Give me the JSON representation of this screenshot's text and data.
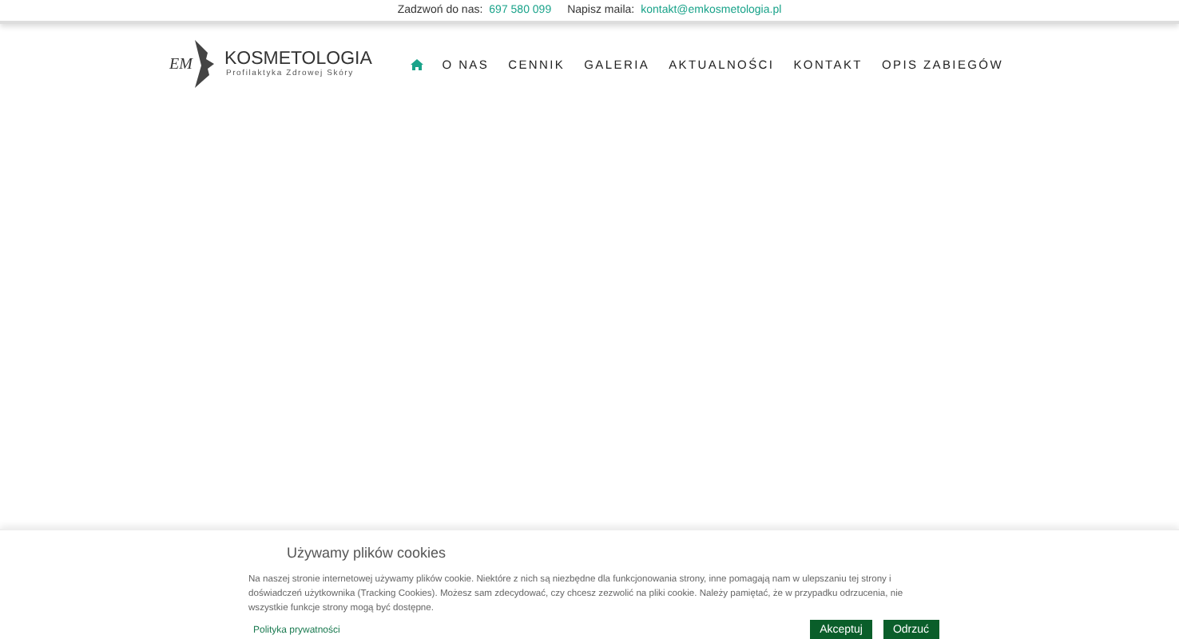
{
  "topbar": {
    "phone_label": "Zadzwoń do nas:",
    "phone": "697 580 099",
    "mail_label": "Napisz maila:",
    "mail": "kontakt@emkosmetologia.pl"
  },
  "logo": {
    "mark": "EM",
    "title": "KOSMETOLOGIA",
    "subtitle": "Profilaktyka Zdrowej Skóry"
  },
  "nav": [
    {
      "kind": "home",
      "selected": true
    },
    {
      "kind": "text",
      "label": "O NAS",
      "selected": false
    },
    {
      "kind": "text",
      "label": "CENNIK",
      "selected": false
    },
    {
      "kind": "text",
      "label": "GALERIA",
      "selected": false
    },
    {
      "kind": "text",
      "label": "AKTUALNOŚCI",
      "selected": false
    },
    {
      "kind": "text",
      "label": "KONTAKT",
      "selected": false
    },
    {
      "kind": "text",
      "label": "OPIS ZABIEGÓW",
      "selected": false
    }
  ],
  "cookies": {
    "title": "Używamy plików cookies",
    "text": "Na naszej stronie internetowej używamy plików cookie. Niektóre z nich są niezbędne dla funkcjonowania strony, inne pomagają nam w ulepszaniu tej strony i doświadczeń użytkownika (Tracking Cookies). Możesz sam zdecydować, czy chcesz zezwolić na pliki cookie. Należy pamiętać, że w przypadku odrzucenia, nie wszystkie funkcje strony mogą być dostępne.",
    "link": "Polityka prywatności",
    "buttons": [
      "Akceptuj",
      "Odrzuć"
    ]
  }
}
